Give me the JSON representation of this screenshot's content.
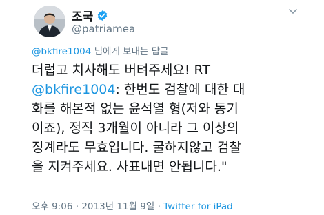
{
  "author": {
    "display_name": "조국",
    "handle": "@patriamea"
  },
  "reply": {
    "to_handle": "@bkfire1004",
    "suffix": " 님에게 보내는 답글"
  },
  "body": {
    "line1": "더럽고 치사해도 버텨주세요! RT",
    "line2_mention": "@bkfire1004",
    "line2_rest": ": 한번도 검찰에 대한 대",
    "line3": "화를 해본적 없는 윤석열 형(저와 동기",
    "line4": "이죠), 정직 3개월이 아니라 그 이상의",
    "line5": "징계라도 무효입니다. 굴하지않고 검찰",
    "line6": "을 지켜주세요. 사표내면 안됩니다.\""
  },
  "meta": {
    "timestamp": "오후 9:06 · 2013년 11월 9일 · ",
    "source": "Twitter for iPad"
  },
  "colors": {
    "link": "#1b95e0",
    "secondary_text": "#657786",
    "verified_badge": "#1da1f2"
  },
  "icons": {
    "verified": "verified-badge-icon",
    "menu": "chevron-down-icon"
  }
}
